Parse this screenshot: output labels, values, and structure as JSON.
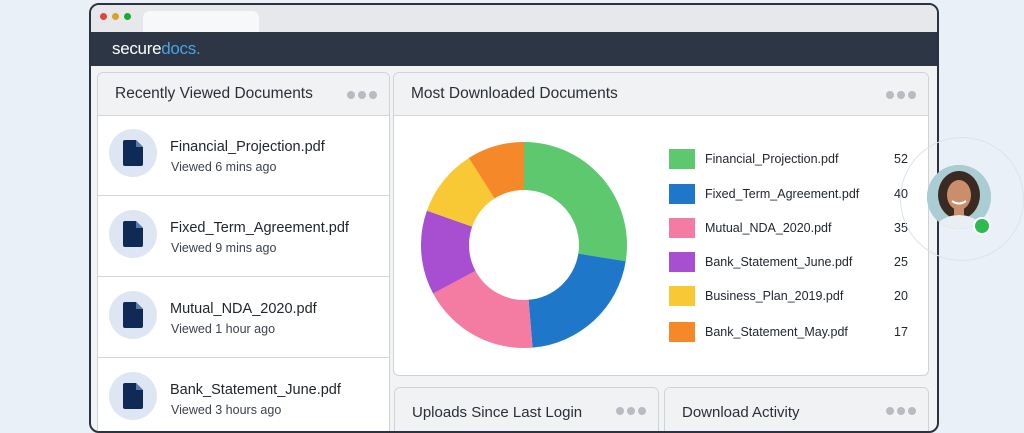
{
  "app": {
    "logo_main": "secure",
    "logo_accent": "docs",
    "logo_dot": "."
  },
  "recent": {
    "title": "Recently Viewed Documents",
    "items": [
      {
        "name": "Financial_Projection.pdf",
        "time": "Viewed 6 mins ago"
      },
      {
        "name": "Fixed_Term_Agreement.pdf",
        "time": "Viewed 9 mins ago"
      },
      {
        "name": "Mutual_NDA_2020.pdf",
        "time": "Viewed 1 hour ago"
      },
      {
        "name": "Bank_Statement_June.pdf",
        "time": "Viewed 3 hours ago"
      }
    ]
  },
  "most_downloaded": {
    "title": "Most Downloaded Documents",
    "legend": [
      {
        "name": "Financial_Projection.pdf",
        "count": "52",
        "color": "#5ec86f"
      },
      {
        "name": "Fixed_Term_Agreement.pdf",
        "count": "40",
        "color": "#1f77c9"
      },
      {
        "name": "Mutual_NDA_2020.pdf",
        "count": "35",
        "color": "#f47ba1"
      },
      {
        "name": "Bank_Statement_June.pdf",
        "count": "25",
        "color": "#a74fd0"
      },
      {
        "name": "Business_Plan_2019.pdf",
        "count": "20",
        "color": "#f8c934"
      },
      {
        "name": "Bank_Statement_May.pdf",
        "count": "17",
        "color": "#f5892a"
      }
    ]
  },
  "chart_data": {
    "type": "pie",
    "categories": [
      "Financial_Projection.pdf",
      "Fixed_Term_Agreement.pdf",
      "Mutual_NDA_2020.pdf",
      "Bank_Statement_June.pdf",
      "Business_Plan_2019.pdf",
      "Bank_Statement_May.pdf"
    ],
    "values": [
      52,
      40,
      35,
      25,
      20,
      17
    ],
    "colors": [
      "#5ec86f",
      "#1f77c9",
      "#f47ba1",
      "#a74fd0",
      "#f8c934",
      "#f5892a"
    ],
    "title": "Most Downloaded Documents",
    "legend": "right"
  },
  "uploads": {
    "title": "Uploads Since Last Login"
  },
  "activity": {
    "title": "Download Activity"
  },
  "avatar": {
    "status": "online",
    "status_color": "#2dbb4f"
  }
}
